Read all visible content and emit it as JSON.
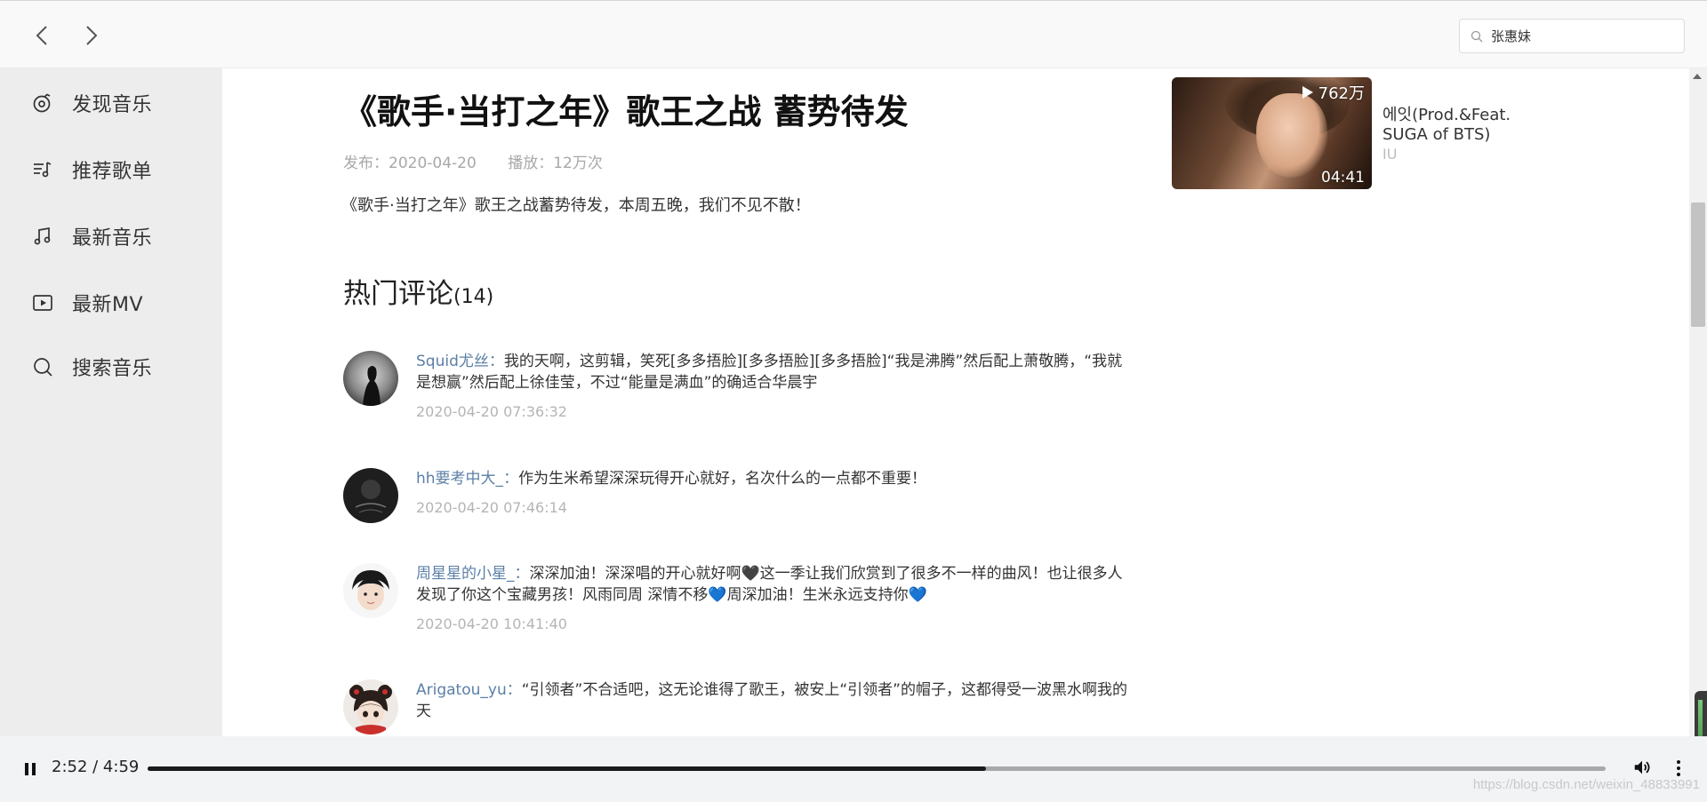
{
  "search": {
    "value": "张惠妹",
    "placeholder": ""
  },
  "sidebar": {
    "items": [
      {
        "label": "发现音乐",
        "icon": "discover-icon"
      },
      {
        "label": "推荐歌单",
        "icon": "playlist-icon"
      },
      {
        "label": "最新音乐",
        "icon": "music-note-icon"
      },
      {
        "label": "最新MV",
        "icon": "video-icon"
      },
      {
        "label": "搜索音乐",
        "icon": "search-icon"
      }
    ]
  },
  "mv": {
    "title": "《歌手·当打之年》歌王之战 蓄势待发",
    "publish": "发布：2020-04-20",
    "plays": "播放：12万次",
    "description": "《歌手·当打之年》歌王之战蓄势待发，本周五晚，我们不见不散！"
  },
  "comments": {
    "heading": "热门评论",
    "count": "(14)",
    "items": [
      {
        "user": "Squid尤丝",
        "sep": "：",
        "text": "我的天啊，这剪辑，笑死[多多捂脸][多多捂脸][多多捂脸]“我是沸腾”然后配上萧敬腾，“我就是想赢”然后配上徐佳莹，不过“能量是满血”的确适合华晨宇",
        "time": "2020-04-20 07:36:32"
      },
      {
        "user": "hh要考中大_",
        "sep": "：",
        "text": "作为生米希望深深玩得开心就好，名次什么的一点都不重要！",
        "time": "2020-04-20 07:46:14"
      },
      {
        "user": "周星星的小星_",
        "sep": "：",
        "text": "深深加油！深深唱的开心就好啊🖤这一季让我们欣赏到了很多不一样的曲风！也让很多人发现了你这个宝藏男孩！风雨同周 深情不移💙周深加油！生米永远支持你💙",
        "time": "2020-04-20 10:41:40"
      },
      {
        "user": "Arigatou_yu",
        "sep": "：",
        "text": "“引领者”不合适吧，这无论谁得了歌王，被安上“引领者”的帽子，这都得受一波黑水啊我的天",
        "time": ""
      }
    ]
  },
  "related": {
    "plays": "762万",
    "duration": "04:41",
    "name": "에잇(Prod.&Feat. SUGA of BTS)",
    "artist": "IU"
  },
  "player": {
    "time": "2:52 / 4:59",
    "progress": 0.575
  },
  "watermark": "https://blog.csdn.net/weixin_48833991",
  "colors": {
    "username": "#5a7fa6",
    "sidebar_bg": "#ededed",
    "meta_gray": "#a8a8a8",
    "player_bg": "#f1f3f4"
  }
}
